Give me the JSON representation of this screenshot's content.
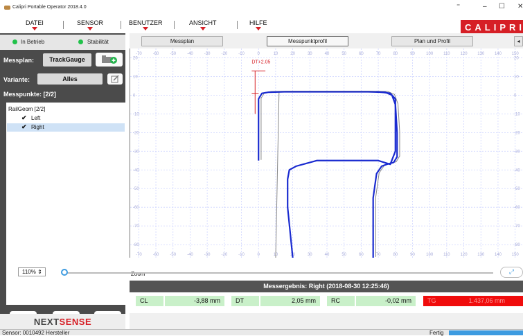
{
  "app": {
    "title": "Calipri Portable Operator 2018.4.0",
    "brand": "CALIPRI"
  },
  "window_controls": {
    "extra": "⁼",
    "minimize": "–",
    "maximize": "☐",
    "close": "✕"
  },
  "menu": {
    "items": [
      "DATEI",
      "SENSOR",
      "BENUTZER",
      "ANSICHT",
      "HILFE"
    ]
  },
  "status": {
    "operation": "In Betrieb",
    "stability": "Stabilität"
  },
  "measure_plan": {
    "label": "Messplan:",
    "value": "TrackGauge"
  },
  "variant": {
    "label": "Variante:",
    "value": "Alles"
  },
  "points": {
    "label": "Messpunkte: [2/2]"
  },
  "tree": {
    "root": "RailGeom [2/2]",
    "items": [
      "Left",
      "Right"
    ]
  },
  "tabs": [
    "Messplan",
    "Messpunktprofil",
    "Plan und Profil"
  ],
  "footer": {
    "brand_a": "NEXT",
    "brand_b": "SENSE"
  },
  "statusbar": {
    "left": "Sensor: 0010492 Hersteller",
    "right": "Fertig"
  },
  "zoom": {
    "label": "Zoom",
    "value": "110%"
  },
  "result": {
    "header": "Messergebnis: Right (2018-08-30 12:25:46)",
    "cells": [
      {
        "name": "CL",
        "value": "-3,88 mm"
      },
      {
        "name": "DT",
        "value": "2,05 mm"
      },
      {
        "name": "RC",
        "value": "-0,02 mm"
      },
      {
        "name": "TG",
        "value": "1.437,06 mm"
      }
    ]
  },
  "chart_data": {
    "type": "line",
    "annotation": "DT+2.05",
    "x_ticks": [
      -70,
      -60,
      -50,
      -40,
      -30,
      -20,
      -10,
      0,
      10,
      20,
      30,
      40,
      50,
      60,
      70,
      80,
      90,
      100,
      110,
      120,
      130,
      140,
      150
    ],
    "y_ticks": [
      20,
      10,
      0,
      -10,
      -20,
      -30,
      -40,
      -50,
      -60,
      -70,
      -80
    ],
    "xlim": [
      -75,
      155
    ],
    "ylim": [
      -87,
      25
    ],
    "grid": true,
    "colors": {
      "measured": "#1a2bd0",
      "reference": "#888888",
      "annotation": "#d61f26",
      "grid": "#cfd5ff"
    },
    "series": [
      {
        "x": [
          20,
          17,
          17,
          18,
          20,
          22,
          26,
          34,
          40,
          60,
          70,
          77,
          80,
          80,
          77,
          73,
          69,
          69,
          70,
          70
        ],
        "y": [
          -87,
          -60,
          -45,
          -40,
          -39,
          -38,
          -37,
          -35,
          -35,
          -35,
          -35,
          -37,
          -30,
          -2,
          1,
          1.5,
          1.8,
          1.8,
          1.8,
          1.8
        ]
      },
      {
        "x": [
          0,
          0,
          2,
          6,
          15,
          40,
          64,
          74,
          78,
          80,
          81,
          81,
          79,
          75,
          72,
          69,
          67,
          67
        ],
        "y": [
          -35,
          -2,
          1,
          1.6,
          1.8,
          1.8,
          1.8,
          1.6,
          0,
          -5,
          -20,
          -33,
          -36,
          -37,
          -38,
          -42,
          -55,
          -87
        ]
      }
    ]
  }
}
